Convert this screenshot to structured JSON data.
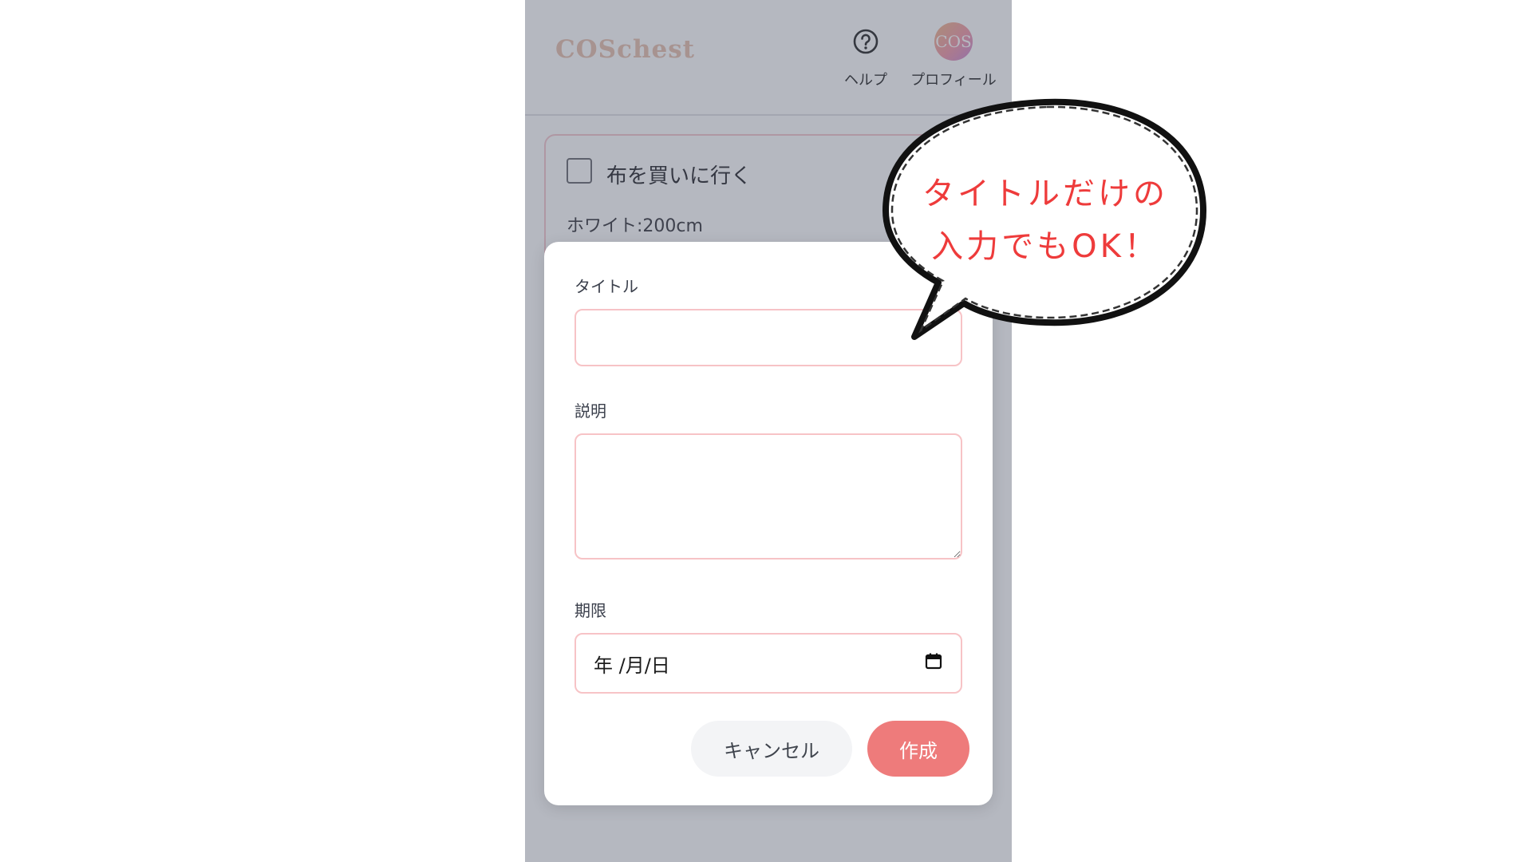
{
  "app": {
    "logo": "COSchest"
  },
  "header": {
    "help_label": "ヘルプ",
    "profile_label": "プロフィール",
    "avatar_text": "COS"
  },
  "task_card": {
    "title": "布を買いに行く",
    "description": "ホワイト:200cm"
  },
  "modal": {
    "title_label": "タイトル",
    "title_value": "",
    "description_label": "説明",
    "description_value": "",
    "deadline_label": "期限",
    "deadline_placeholder": "年 /月/日",
    "cancel_label": "キャンセル",
    "create_label": "作成"
  },
  "annotation": {
    "line1": "タイトルだけの",
    "line2": "入力でもOK！"
  },
  "colors": {
    "accent": "#ee7b7b",
    "field_border": "#f7c3c6",
    "annotation_text": "#ee3b3b",
    "overlay": "#464e62"
  },
  "icons": {
    "help": "question-circle-icon",
    "calendar": "calendar-icon"
  }
}
